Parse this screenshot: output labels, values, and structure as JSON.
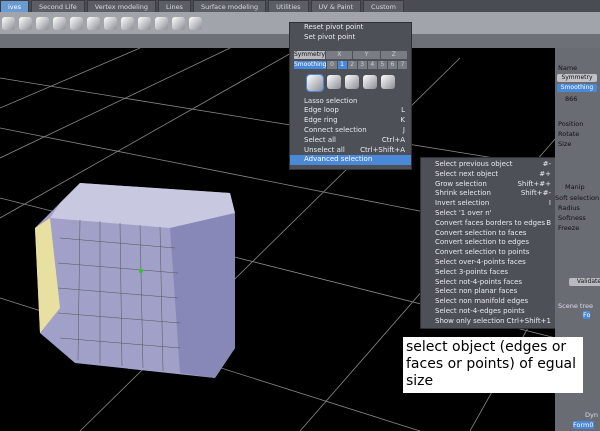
{
  "tabs": [
    "ives",
    "Second Life",
    "Vertex modeling",
    "Lines",
    "Surface modeling",
    "Utilities",
    "UV & Paint",
    "Custom"
  ],
  "menu1": {
    "pivot": [
      "Reset pivot point",
      "Set pivot point"
    ],
    "symmetry": "Symmetry",
    "axes": [
      "X",
      "Y",
      "Z"
    ],
    "smoothing": "Smoothing",
    "levels": [
      "0",
      "1",
      "2",
      "3",
      "4",
      "5",
      "6",
      "7"
    ],
    "items": [
      {
        "label": "Lasso selection",
        "key": ""
      },
      {
        "label": "Edge loop",
        "key": "L"
      },
      {
        "label": "Edge ring",
        "key": "K"
      },
      {
        "label": "Connect selection",
        "key": "J"
      },
      {
        "label": "Select all",
        "key": "Ctrl+A"
      },
      {
        "label": "Unselect all",
        "key": "Ctrl+Shift+A"
      },
      {
        "label": "Advanced selection",
        "key": ""
      }
    ]
  },
  "menu2": [
    {
      "label": "Select previous object",
      "key": "#-"
    },
    {
      "label": "Select next object",
      "key": "#+"
    },
    {
      "label": "Grow selection",
      "key": "Shift+#+"
    },
    {
      "label": "Shrink selection",
      "key": "Shift+#-"
    },
    {
      "label": "Invert selection",
      "key": "I"
    },
    {
      "label": "Select '1 over n'",
      "key": ""
    },
    {
      "label": "Convert faces borders to edges",
      "key": "B"
    },
    {
      "label": "Convert selection to faces",
      "key": ""
    },
    {
      "label": "Convert selection to edges",
      "key": ""
    },
    {
      "label": "Convert selection to points",
      "key": ""
    },
    {
      "label": "Select over-4-points faces",
      "key": ""
    },
    {
      "label": "Select 3-points faces",
      "key": ""
    },
    {
      "label": "Select not-4-points faces",
      "key": ""
    },
    {
      "label": "Select non planar faces",
      "key": ""
    },
    {
      "label": "Select non manifold edges",
      "key": ""
    },
    {
      "label": "Select not-4-edges points",
      "key": ""
    },
    {
      "label": "Show only selection",
      "key": "Ctrl+Shift+1"
    }
  ],
  "right": {
    "name": "Name",
    "symmetry": "Symmetry",
    "smoothing": "Smoothing",
    "count": "866",
    "position": "Position",
    "rotate": "Rotate",
    "size": "Size",
    "manip": "Manip",
    "soft": "Soft selection",
    "radius": "Radius",
    "softness": "Softness",
    "freeze": "Freeze",
    "validate": "Validate",
    "scene_tree": "Scene tree",
    "form_top": "Fo",
    "dyn": "Dyn",
    "form": "Form0"
  },
  "note": "select object (edges or faces or points) of egual size"
}
